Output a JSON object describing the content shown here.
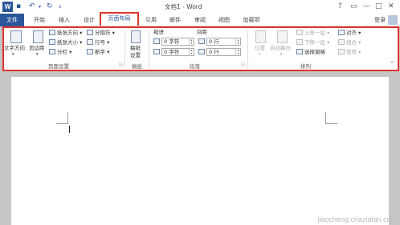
{
  "titlebar": {
    "logo": "W",
    "title": "文档1 - Word",
    "help": "?",
    "controls": [
      "▭",
      "—",
      "□",
      "✕"
    ]
  },
  "quick_access": {
    "save": "💾",
    "undo": "↶",
    "redo": "↻",
    "more": "▾"
  },
  "tabs": [
    {
      "label": "文件"
    },
    {
      "label": "开始"
    },
    {
      "label": "插入"
    },
    {
      "label": "设计"
    },
    {
      "label": "页面布局"
    },
    {
      "label": "引用"
    },
    {
      "label": "邮件"
    },
    {
      "label": "审阅"
    },
    {
      "label": "视图"
    },
    {
      "label": "加载项"
    }
  ],
  "login_label": "登录",
  "ribbon": {
    "page_setup": {
      "label": "页面设置",
      "text_direction": "文字方向",
      "margins": "页边距",
      "orientation": "纸张方向",
      "size": "纸张大小",
      "columns": "分栏",
      "breaks": "分隔符",
      "line_numbers": "行号",
      "hyphenation": "断字"
    },
    "manuscript": {
      "label": "稿纸",
      "button_line1": "稿纸",
      "button_line2": "设置"
    },
    "paragraph": {
      "label": "段落",
      "indent_header": "缩进",
      "spacing_header": "间距",
      "indent_left": "0 字符",
      "indent_right": "0 字符",
      "spacing_before": "0 行",
      "spacing_after": "0 行"
    },
    "arrange": {
      "label": "排列",
      "position": "位置",
      "wrap_text": "自动换行",
      "bring_forward": "上移一层",
      "send_backward": "下移一层",
      "selection_pane": "选择窗格",
      "align": "对齐",
      "group": "组合",
      "rotate": "旋转"
    }
  },
  "watermark": "jiaocheng.chazidian.com"
}
